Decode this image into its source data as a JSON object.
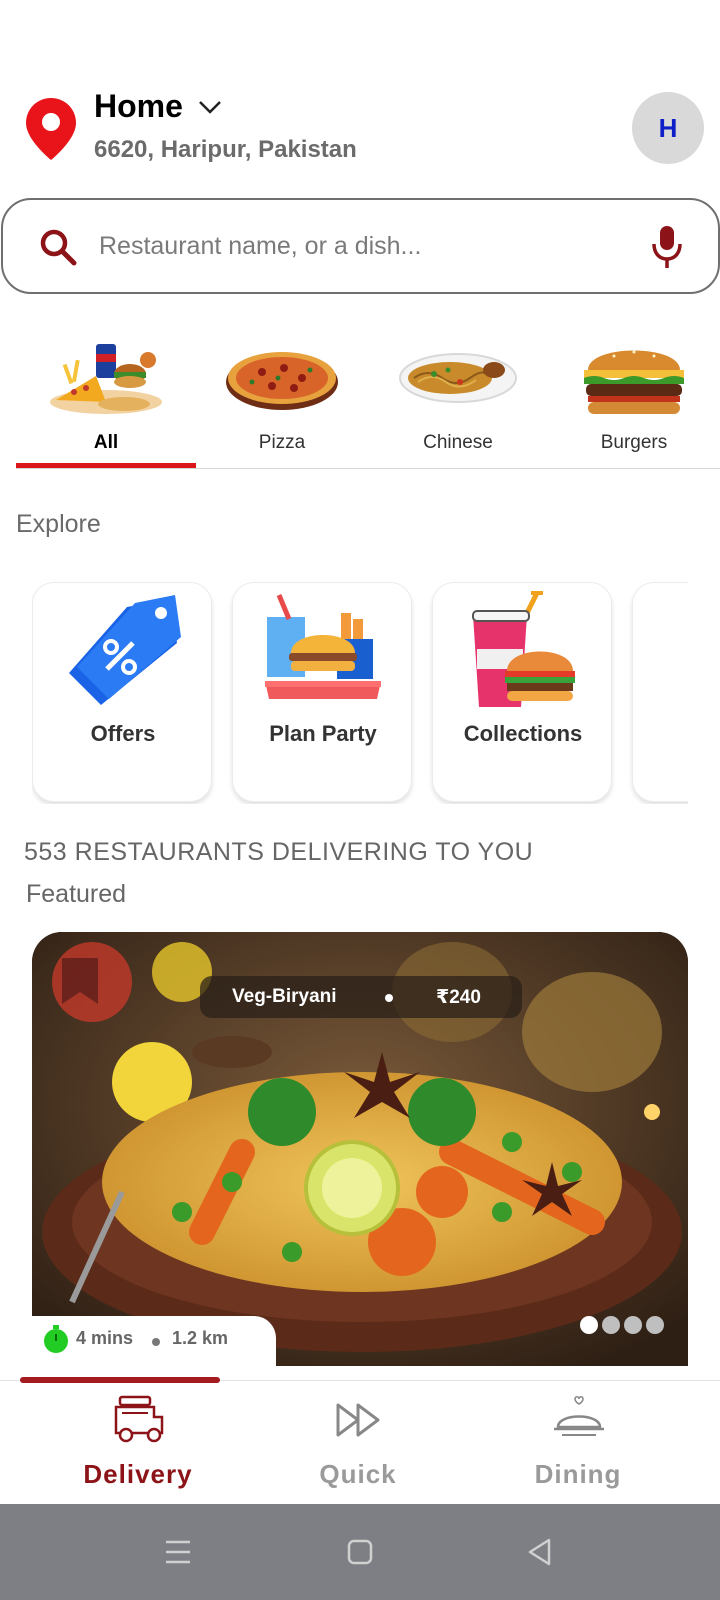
{
  "header": {
    "location_title": "Home",
    "location_address": "6620, Haripur, Pakistan",
    "avatar_initial": "H"
  },
  "search": {
    "placeholder": "Restaurant name, or a dish..."
  },
  "categories": [
    {
      "label": "All",
      "icon": "combo-meal-icon",
      "active": true
    },
    {
      "label": "Pizza",
      "icon": "pizza-icon",
      "active": false
    },
    {
      "label": "Chinese",
      "icon": "noodles-icon",
      "active": false
    },
    {
      "label": "Burgers",
      "icon": "burger-icon",
      "active": false
    }
  ],
  "explore": {
    "heading": "Explore",
    "cards": [
      {
        "label": "Offers",
        "icon": "discount-tag-icon"
      },
      {
        "label": "Plan Party",
        "icon": "party-tray-icon"
      },
      {
        "label": "Collections",
        "icon": "drink-burger-icon"
      },
      {
        "label": "",
        "icon": "chef-icon"
      }
    ]
  },
  "restaurants": {
    "count_text": "553 RESTAURANTS DELIVERING TO YOU",
    "featured_heading": "Featured"
  },
  "featured_card": {
    "dish_name": "Veg-Biryani",
    "price": "₹240",
    "time": "4 mins",
    "distance": "1.2 km",
    "page_count": 4,
    "active_page": 1
  },
  "bottom_nav": [
    {
      "label": "Delivery",
      "icon": "delivery-cart-icon",
      "active": true
    },
    {
      "label": "Quick",
      "icon": "fast-forward-icon",
      "active": false
    },
    {
      "label": "Dining",
      "icon": "cloche-icon",
      "active": false
    }
  ],
  "colors": {
    "accent": "#d9161b",
    "nav_active": "#8c1418",
    "avatar_text": "#1020c8"
  }
}
